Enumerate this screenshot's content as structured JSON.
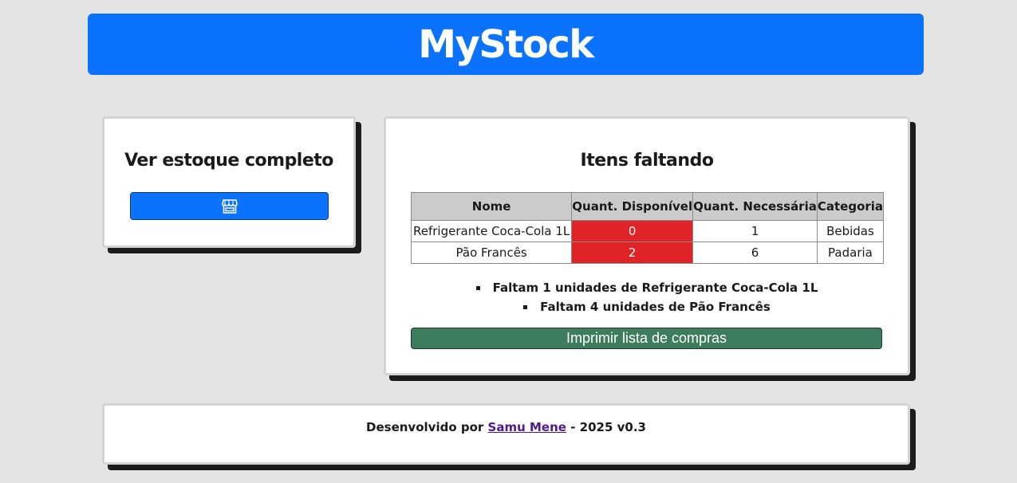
{
  "header": {
    "title": "MyStock"
  },
  "stock_card": {
    "title": "Ver estoque completo",
    "button_icon": "store-icon"
  },
  "missing_card": {
    "title": "Itens faltando",
    "table": {
      "headers": [
        "Nome",
        "Quant. Disponível",
        "Quant. Necessária",
        "Categoria"
      ],
      "rows": [
        {
          "name": "Refrigerante Coca-Cola 1L",
          "available": "0",
          "needed": "1",
          "category": "Bebidas"
        },
        {
          "name": "Pão Francês",
          "available": "2",
          "needed": "6",
          "category": "Padaria"
        }
      ]
    },
    "missing_list": [
      "Faltam 1 unidades de Refrigerante Coca-Cola 1L",
      "Faltam 4 unidades de Pão Francês"
    ],
    "print_button": "Imprimir lista de compras"
  },
  "footer": {
    "prefix": "Desenvolvido por",
    "author": "Samu Mene",
    "suffix": "- 2025 v0.3"
  },
  "colors": {
    "primary": "#0b72fd",
    "low_stock": "#e02326",
    "print_button": "#3d7c5c",
    "background": "#e5e4e5"
  }
}
